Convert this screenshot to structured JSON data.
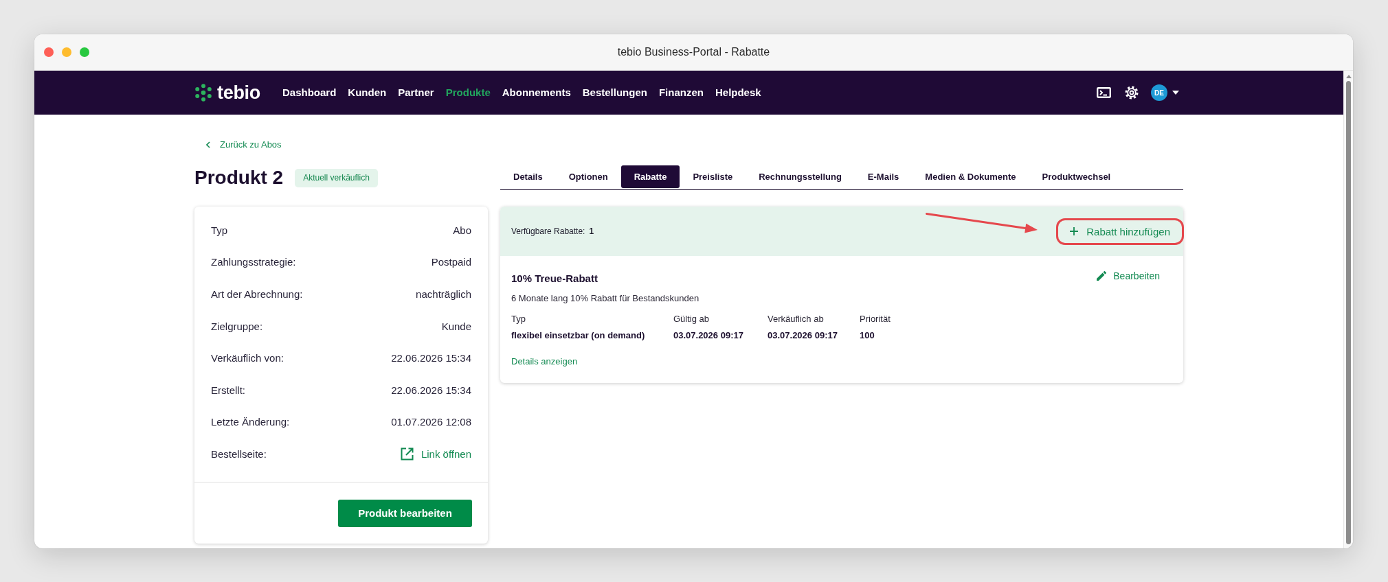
{
  "window": {
    "title": "tebio Business-Portal - Rabatte"
  },
  "nav": {
    "logo": "tebio",
    "items": [
      {
        "label": "Dashboard",
        "selected": false
      },
      {
        "label": "Kunden",
        "selected": false
      },
      {
        "label": "Partner",
        "selected": false
      },
      {
        "label": "Produkte",
        "selected": true
      },
      {
        "label": "Abonnements",
        "selected": false
      },
      {
        "label": "Bestellungen",
        "selected": false
      },
      {
        "label": "Finanzen",
        "selected": false
      },
      {
        "label": "Helpdesk",
        "selected": false
      }
    ],
    "avatar": "DE"
  },
  "back_link": "Zurück zu Abos",
  "product": {
    "title": "Produkt 2",
    "badge": "Aktuell verkäuflich",
    "details": [
      {
        "kind": "text",
        "label": "Typ",
        "value": "Abo"
      },
      {
        "kind": "text",
        "label": "Zahlungsstrategie:",
        "value": "Postpaid"
      },
      {
        "kind": "text",
        "label": "Art der Abrechnung:",
        "value": "nachträglich"
      },
      {
        "kind": "text",
        "label": "Zielgruppe:",
        "value": "Kunde"
      },
      {
        "kind": "text",
        "label": "Verkäuflich von:",
        "value": "22.06.2026 15:34"
      },
      {
        "kind": "text",
        "label": "Erstellt:",
        "value": "22.06.2026 15:34"
      },
      {
        "kind": "text",
        "label": "Letzte Änderung:",
        "value": "01.07.2026 12:08"
      },
      {
        "kind": "link",
        "label": "Bestellseite:",
        "value": "Link öffnen"
      }
    ],
    "edit_button": "Produkt bearbeiten"
  },
  "tabs": [
    {
      "label": "Details",
      "selected": false
    },
    {
      "label": "Optionen",
      "selected": false
    },
    {
      "label": "Rabatte",
      "selected": true
    },
    {
      "label": "Preisliste",
      "selected": false
    },
    {
      "label": "Rechnungsstellung",
      "selected": false
    },
    {
      "label": "E-Mails",
      "selected": false
    },
    {
      "label": "Medien & Dokumente",
      "selected": false
    },
    {
      "label": "Produktwechsel",
      "selected": false
    }
  ],
  "discounts": {
    "count_label": "Verfügbare Rabatte:",
    "count": "1",
    "add_button": {
      "label": "Rabatt hinzufügen",
      "highlighted": true
    },
    "items": [
      {
        "title": "10% Treue-Rabatt",
        "description": "6 Monate lang 10% Rabatt für Bestandskunden",
        "edit": "Bearbeiten",
        "fields": [
          {
            "label": "Typ",
            "value": "flexibel einsetzbar (on demand)"
          },
          {
            "label": "Gültig ab",
            "value": "03.07.2026 09:17"
          },
          {
            "label": "Verkäuflich ab",
            "value": "03.07.2026 09:17"
          },
          {
            "label": "Priorität",
            "value": "100"
          }
        ],
        "details_link": "Details anzeigen"
      }
    ]
  }
}
